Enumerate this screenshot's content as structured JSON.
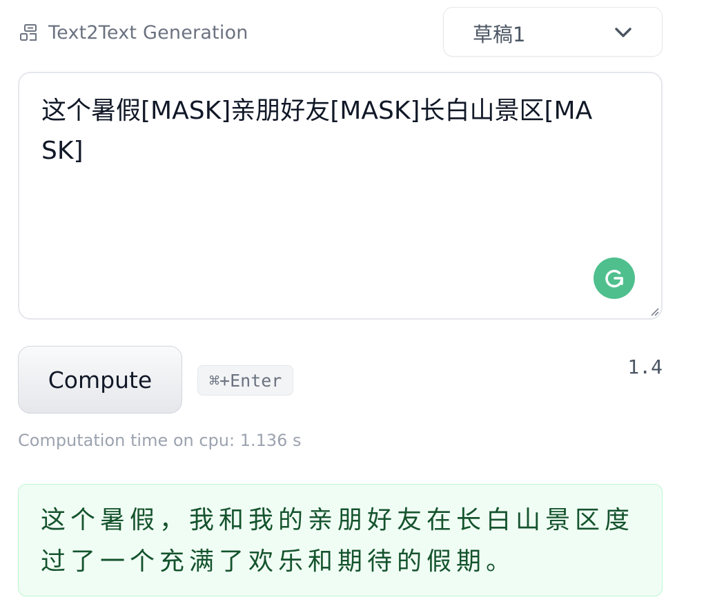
{
  "header": {
    "task_icon": "text2text-generation-icon",
    "task_label": "Text2Text Generation"
  },
  "example_select": {
    "value": "草稿1",
    "icon": "chevron-down-icon"
  },
  "input": {
    "text": "这个暑假[MASK]亲朋好友[MASK]长白山景区[MASK]",
    "grammarly_icon": "grammarly-icon",
    "resize_icon": "resize-handle-icon"
  },
  "compute": {
    "button_label": "Compute",
    "shortcut": "⌘+Enter",
    "version": "1.4"
  },
  "status": {
    "computation_time": "Computation time on cpu: 1.136 s"
  },
  "output": {
    "text": "这个暑假，我和我的亲朋好友在长白山景区度过了一个充满了欢乐和期待的假期。"
  },
  "colors": {
    "grammarly_green": "#4fbf8d",
    "output_background": "#f0fdf4",
    "output_border": "#bbf7d0",
    "output_text": "#14532d",
    "muted_text": "#9ca3af"
  }
}
